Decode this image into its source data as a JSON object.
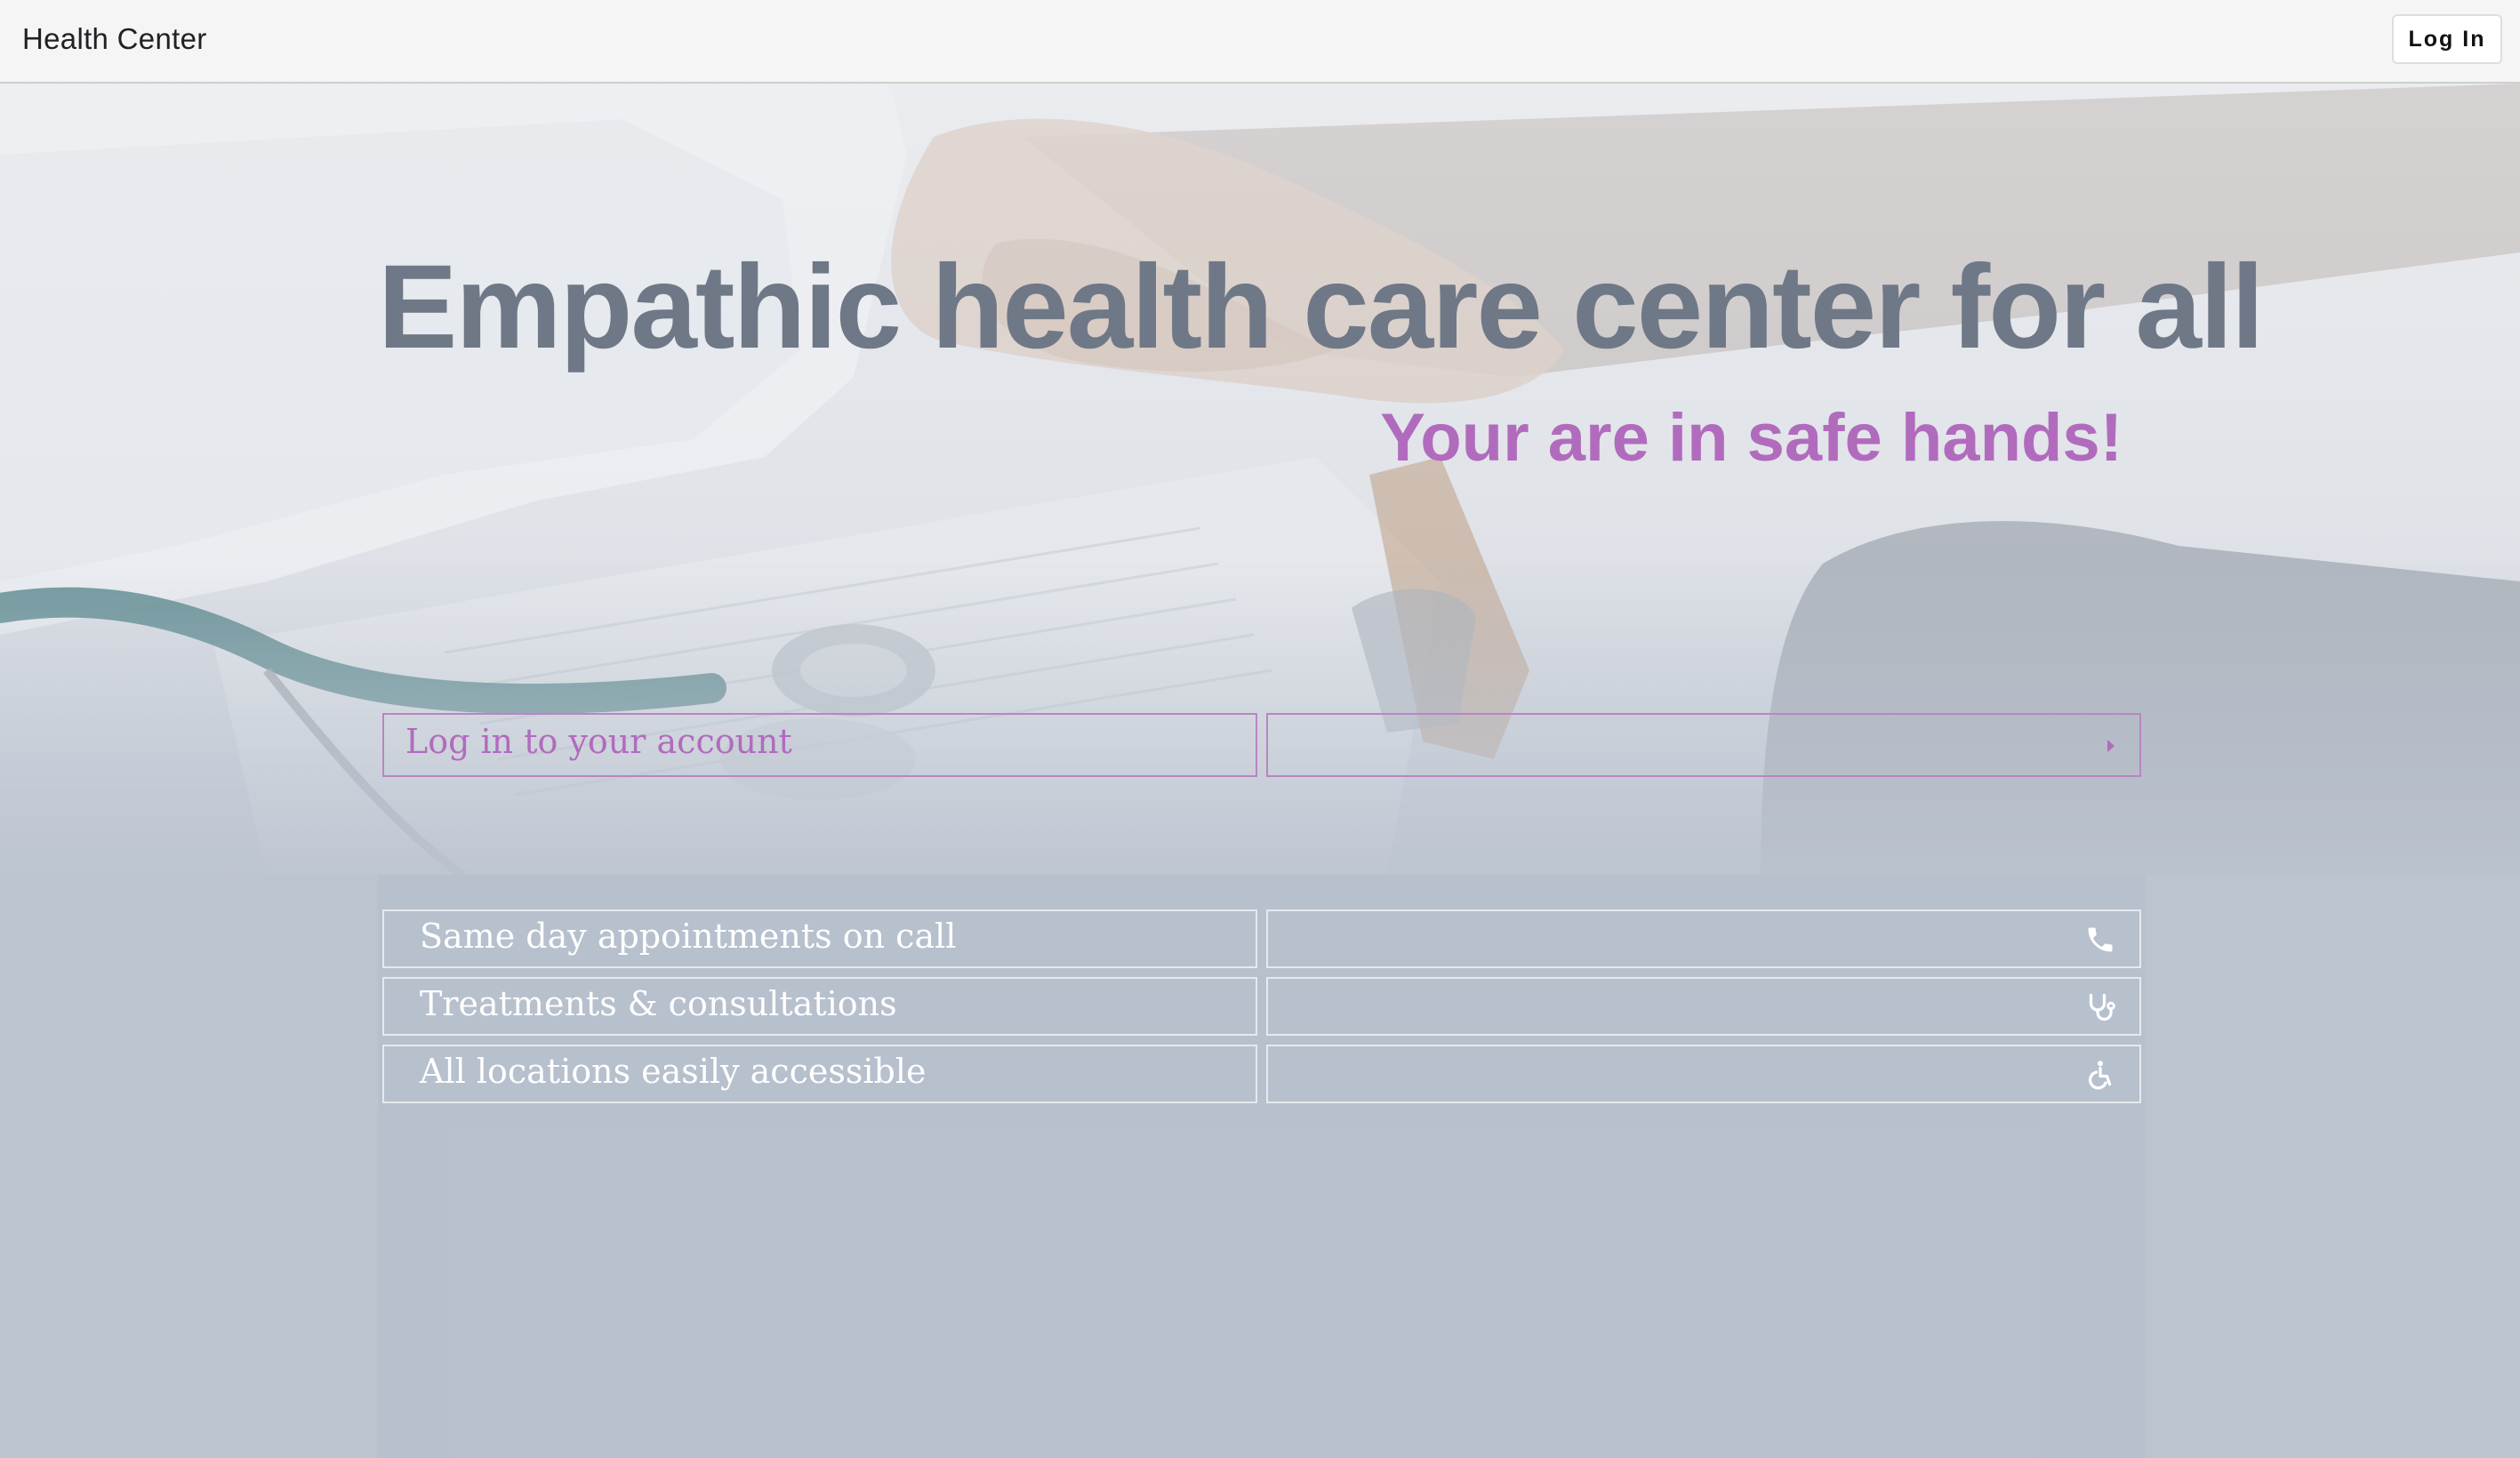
{
  "header": {
    "brand": "Health Center",
    "login_label": "Log In"
  },
  "hero": {
    "title": "Empathic health care center for all",
    "subtitle": "Your are in safe hands!",
    "login_prompt": "Log in to your account"
  },
  "features": [
    {
      "label": "Same day appointments on call",
      "icon": "phone-icon"
    },
    {
      "label": "Treatments & consultations",
      "icon": "stethoscope-icon"
    },
    {
      "label": "All locations easily accessible",
      "icon": "accessible-icon"
    }
  ],
  "colors": {
    "accent": "#b16bbd",
    "title": "#6f7886",
    "background": "#bcc4d0"
  }
}
